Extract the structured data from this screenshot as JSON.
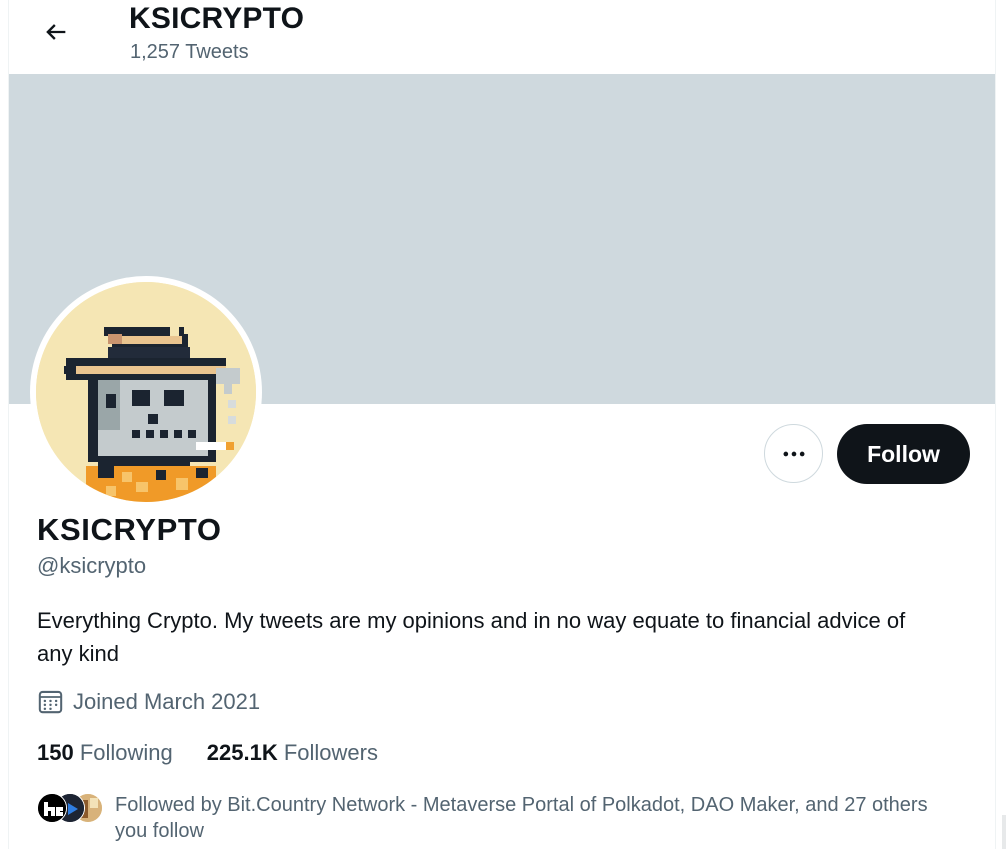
{
  "header": {
    "back_icon": "arrow-left-icon",
    "title": "KSICRYPTO",
    "tweet_count": "1,257 Tweets"
  },
  "colors": {
    "banner": "#cfd9de",
    "primary_text": "#0f1419",
    "secondary_text": "#536471",
    "follow_button_bg": "#0f1419",
    "avatar_bg": "#f5e6b4"
  },
  "profile": {
    "display_name": "KSICRYPTO",
    "handle": "@ksicrypto",
    "bio": "Everything Crypto. My tweets are my opinions and in no way equate to financial advice of any kind",
    "joined": "Joined March 2021",
    "joined_icon": "calendar-icon"
  },
  "actions": {
    "more_icon": "more-horizontal-icon",
    "follow_label": "Follow"
  },
  "stats": {
    "following_count": "150",
    "following_label": "Following",
    "followers_count": "225.1K",
    "followers_label": "Followers"
  },
  "followed_by": {
    "text": "Followed by Bit.Country Network - Metaverse Portal of Polkadot, DAO Maker, and 27 others you follow"
  }
}
